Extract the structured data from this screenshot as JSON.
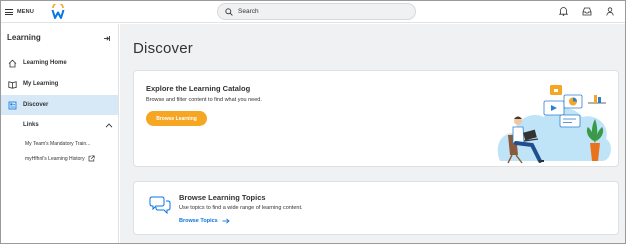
{
  "topbar": {
    "menu_label": "MENU",
    "logo_icon": "workday-logo-icon",
    "search_placeholder": "Search",
    "icons": [
      "bell-icon",
      "inbox-icon",
      "user-icon"
    ]
  },
  "sidebar": {
    "title": "Learning",
    "items": [
      {
        "label": "Learning Home",
        "icon": "home-icon"
      },
      {
        "label": "My Learning",
        "icon": "book-icon"
      },
      {
        "label": "Discover",
        "icon": "discover-icon",
        "active": true
      }
    ],
    "links_header": "Links",
    "links": [
      {
        "label": "My Team's Mandatory Train..."
      },
      {
        "label": "myHfhnl's Learning History",
        "external": true
      }
    ]
  },
  "main": {
    "title": "Discover",
    "catalog_card": {
      "title": "Explore the Learning Catalog",
      "subtitle": "Browse and filter content to find what you need.",
      "button_label": "Browse Learning"
    },
    "topics_card": {
      "title": "Browse Learning Topics",
      "subtitle": "Use topics to find a wide range of learning content.",
      "link_label": "Browse Topics"
    }
  },
  "colors": {
    "accent_orange": "#f5a623",
    "link_blue": "#0875e1",
    "active_bg": "#d7e8f7",
    "page_bg": "#f0f1f2"
  }
}
